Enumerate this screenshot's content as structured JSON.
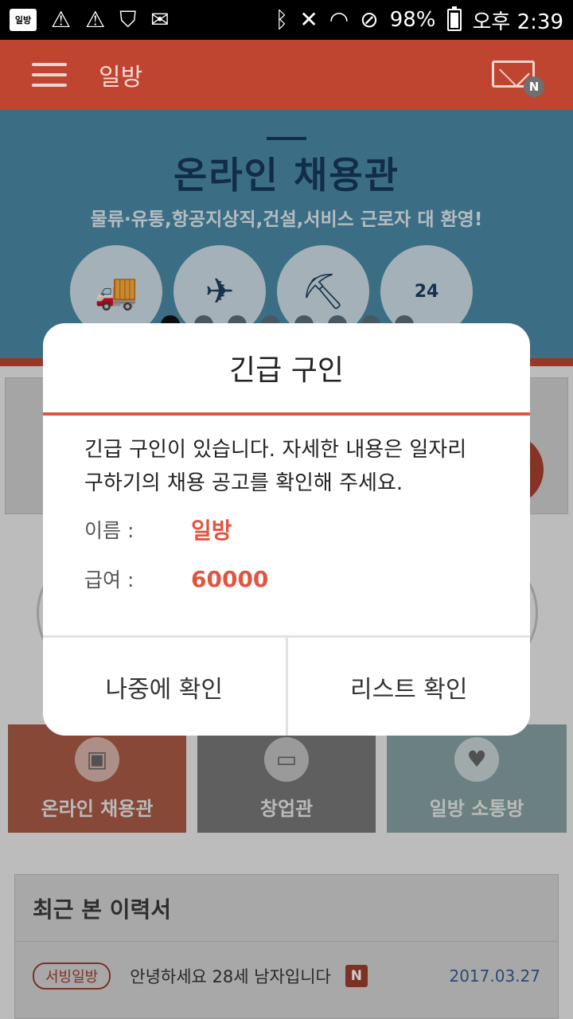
{
  "status_bar": {
    "app_icon_text": "일방",
    "battery": "98%",
    "time": "오후 2:39",
    "icons": [
      "warning-icon",
      "warning-icon",
      "shield-icon",
      "briefcase-icon",
      "bluetooth-icon",
      "mute-icon",
      "wifi-icon",
      "do-not-disturb-icon",
      "battery-icon"
    ]
  },
  "appbar": {
    "title": "일방",
    "mail_badge": "N"
  },
  "banner": {
    "title": "온라인 채용관",
    "subtitle": "물류·유통,항공지상직,건설,서비스 근로자 대 환영!",
    "store_number": "24",
    "slides": 8,
    "active_slide": 1
  },
  "tiles": [
    {
      "label": "온라인 채용관"
    },
    {
      "label": "창업관"
    },
    {
      "label": "일방 소통방"
    }
  ],
  "recent": {
    "header": "최근 본 이력서",
    "rows": [
      {
        "tag": "서빙일방",
        "text": "안녕하세요 28세 남자입니다",
        "badge": "N",
        "date": "2017.03.27"
      }
    ]
  },
  "dialog": {
    "title": "긴급 구인",
    "message": "긴급 구인이 있습니다. 자세한 내용은 일자리 구하기의 채용 공고를 확인해 주세요.",
    "name_label": "이름 :",
    "name_value": "일방",
    "pay_label": "급여 :",
    "pay_value": "60000",
    "later_button": "나중에 확인",
    "list_button": "리스트 확인"
  },
  "colors": {
    "brand": "#c04531",
    "accent": "#e0553f",
    "banner_bg": "#4a8aa6"
  }
}
